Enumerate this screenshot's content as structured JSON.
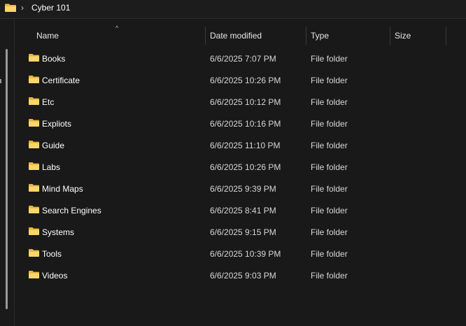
{
  "breadcrumb": {
    "separator": "›",
    "current": "Cyber 101"
  },
  "columns": {
    "name": "Name",
    "date": "Date modified",
    "type": "Type",
    "size": "Size",
    "sort_indicator": "^"
  },
  "colors": {
    "folder_body": "#f2c14e",
    "folder_front": "#f8d66b",
    "background": "#191919"
  },
  "rows": [
    {
      "name": "Books",
      "date": "6/6/2025 7:07 PM",
      "type": "File folder",
      "icon": "folder-icon"
    },
    {
      "name": "Certificate",
      "date": "6/6/2025 10:26 PM",
      "type": "File folder",
      "icon": "folder-icon"
    },
    {
      "name": "Etc",
      "date": "6/6/2025 10:12 PM",
      "type": "File folder",
      "icon": "folder-icon"
    },
    {
      "name": "Expliots",
      "date": "6/6/2025 10:16 PM",
      "type": "File folder",
      "icon": "folder-icon"
    },
    {
      "name": "Guide",
      "date": "6/6/2025 11:10 PM",
      "type": "File folder",
      "icon": "folder-icon"
    },
    {
      "name": "Labs",
      "date": "6/6/2025 10:26 PM",
      "type": "File folder",
      "icon": "folder-icon"
    },
    {
      "name": "Mind Maps",
      "date": "6/6/2025 9:39 PM",
      "type": "File folder",
      "icon": "folder-icon"
    },
    {
      "name": "Search Engines",
      "date": "6/6/2025 8:41 PM",
      "type": "File folder",
      "icon": "folder-icon"
    },
    {
      "name": "Systems",
      "date": "6/6/2025 9:15 PM",
      "type": "File folder",
      "icon": "folder-icon"
    },
    {
      "name": "Tools",
      "date": "6/6/2025 10:39 PM",
      "type": "File folder",
      "icon": "folder-icon"
    },
    {
      "name": "Videos",
      "date": "6/6/2025 9:03 PM",
      "type": "File folder",
      "icon": "folder-icon"
    }
  ]
}
